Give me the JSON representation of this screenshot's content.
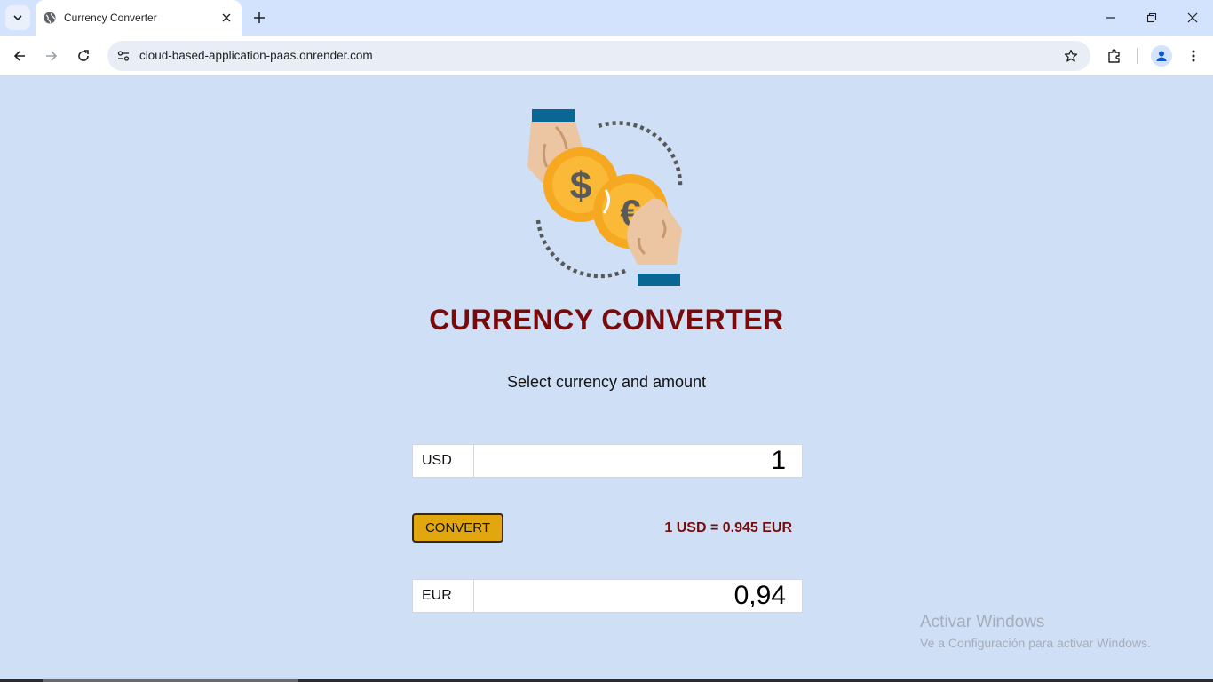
{
  "browser": {
    "tab_title": "Currency Converter",
    "url": "cloud-based-application-paas.onrender.com"
  },
  "page": {
    "title": "CURRENCY CONVERTER",
    "subtitle": "Select currency and amount",
    "from": {
      "currency": "USD",
      "amount": "1"
    },
    "convert_label": "CONVERT",
    "rate_text": "1 USD = 0.945 EUR",
    "to": {
      "currency": "EUR",
      "amount": "0,94"
    }
  },
  "watermark": {
    "title": "Activar Windows",
    "subtitle": "Ve a Configuración para activar Windows."
  },
  "colors": {
    "page_bg": "#cfdff6",
    "title": "#7a0a0a",
    "button": "#e2a70e",
    "coin": "#f6a821",
    "cuff": "#0a6794"
  }
}
